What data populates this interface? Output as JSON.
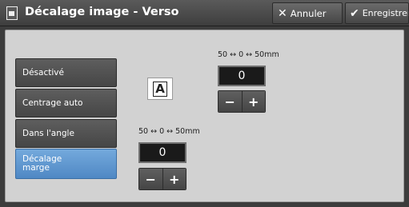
{
  "window": {
    "title": "Décalage image - Verso",
    "cancel_label": "Annuler",
    "save_label": "Enregistrer"
  },
  "options": [
    {
      "label": "Désactivé",
      "selected": false
    },
    {
      "label": "Centrage auto",
      "selected": false
    },
    {
      "label": "Dans l'angle",
      "selected": false
    },
    {
      "label": "Décalage\nmarge",
      "selected": true
    }
  ],
  "preview": {
    "glyph": "A"
  },
  "top_shift": {
    "range": "50 ↔ 0 ↔ 50mm",
    "value": "0",
    "minus": "−",
    "plus": "+"
  },
  "bottom_shift": {
    "range": "50 ↔ 0 ↔ 50mm",
    "value": "0",
    "minus": "−",
    "plus": "+"
  },
  "colors": {
    "selected": "#5b93cc",
    "panel": "#d2d2d2",
    "button": "#505050"
  }
}
